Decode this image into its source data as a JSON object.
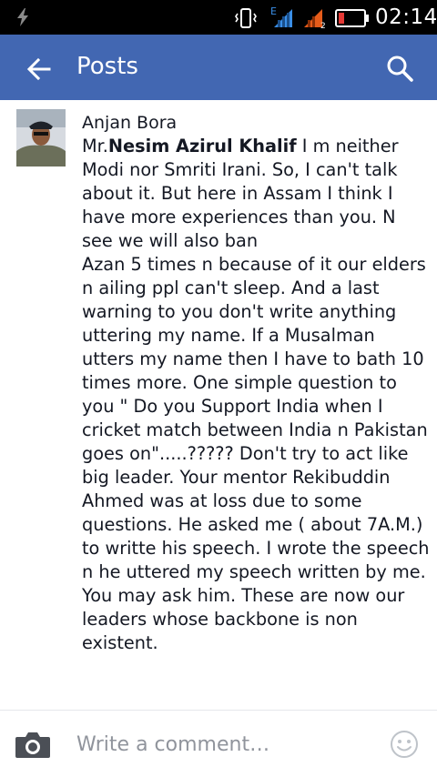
{
  "status_bar": {
    "time": "02:14",
    "network_label": "E",
    "sim_label": "2"
  },
  "app_bar": {
    "title": "Posts",
    "back_icon": "arrow-left-icon",
    "search_icon": "search-icon",
    "color": "#4267b2"
  },
  "comment": {
    "author": "Anjan Bora",
    "mention": "Nesim Azirul Khalif",
    "prefix": "Mr.",
    "text": " I m neither Modi nor Smriti Irani. So, I can't talk about it. But here in Assam I think I have more experiences than you. N see we will also ban\nAzan 5 times n because of it our elders n ailing ppl can't sleep. And a last warning to you don't write anything uttering my name. If a Musalman utters my name then I have to bath 10 times more. One simple question to you \" Do you Support India when I cricket match between India n Pakistan goes on\".....????? Don't try to act like big leader. Your mentor Rekibuddin Ahmed was at loss due to some questions. He asked me ( about 7A.M.) to writte his speech. I wrote the speech n he uttered my speech written by me.\nYou may ask him. These are now our leaders whose backbone is non existent."
  },
  "composer": {
    "placeholder": "Write a comment…",
    "camera_icon": "camera-icon",
    "emoji_icon": "smiley-icon"
  }
}
